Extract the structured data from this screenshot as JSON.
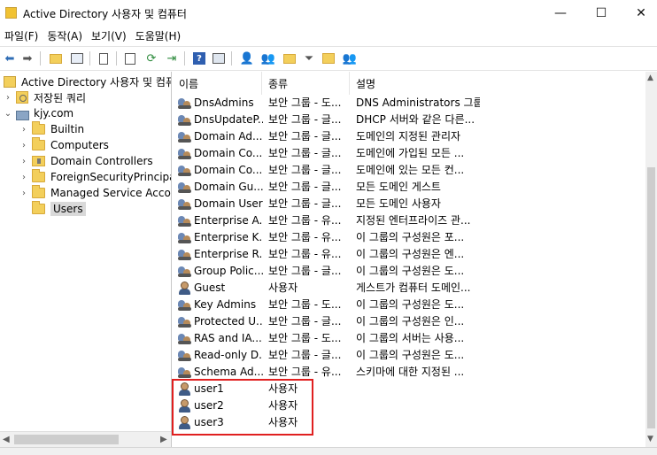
{
  "window": {
    "title": "Active Directory 사용자 및 컴퓨터",
    "icon": "ad-console-icon",
    "minimize_glyph": "—",
    "maximize_glyph": "☐",
    "close_glyph": "✕"
  },
  "menu": [
    {
      "label": "파일(F)"
    },
    {
      "label": "동작(A)"
    },
    {
      "label": "보기(V)"
    },
    {
      "label": "도움말(H)"
    }
  ],
  "toolbar": {
    "icons": [
      "back-arrow-icon",
      "forward-arrow-icon",
      "folder-up-icon",
      "tree-toggle-icon",
      "properties-icon",
      "export-list-icon",
      "refresh-icon",
      "export-icon",
      "help-icon",
      "console-icon",
      "new-user-icon",
      "new-group-icon",
      "new-ou-icon",
      "filter-icon",
      "find-icon",
      "add-to-group-icon"
    ]
  },
  "tree": {
    "root": "Active Directory 사용자 및 컴퓨터",
    "saved_queries": "저장된 쿼리",
    "domain": "kjy.com",
    "children": [
      {
        "label": "Builtin"
      },
      {
        "label": "Computers"
      },
      {
        "label": "Domain Controllers"
      },
      {
        "label": "ForeignSecurityPrincipals"
      },
      {
        "label": "Managed Service Accounts"
      },
      {
        "label": "Users"
      }
    ],
    "selected": "Users",
    "expand_glyph": "›",
    "expanded_glyph": "⌄"
  },
  "list": {
    "columns": [
      {
        "label": "이름"
      },
      {
        "label": "종류"
      },
      {
        "label": "설명"
      }
    ],
    "rows": [
      {
        "name": "DnsAdmins",
        "type": "보안 그룹 - 도...",
        "desc": "DNS Administrators 그룹",
        "icon": "group-icon"
      },
      {
        "name": "DnsUpdateP...",
        "type": "보안 그룹 - 글...",
        "desc": "DHCP 서버와 같은 다른...",
        "icon": "group-icon"
      },
      {
        "name": "Domain Ad...",
        "type": "보안 그룹 - 글...",
        "desc": "도메인의 지정된 관리자",
        "icon": "group-icon"
      },
      {
        "name": "Domain Co...",
        "type": "보안 그룹 - 글...",
        "desc": "도메인에 가입된 모든 ...",
        "icon": "group-icon"
      },
      {
        "name": "Domain Co...",
        "type": "보안 그룹 - 글...",
        "desc": "도메인에 있는 모든 컨...",
        "icon": "group-icon"
      },
      {
        "name": "Domain Gu...",
        "type": "보안 그룹 - 글...",
        "desc": "모든 도메인 게스트",
        "icon": "group-icon"
      },
      {
        "name": "Domain Users",
        "type": "보안 그룹 - 글...",
        "desc": "모든 도메인 사용자",
        "icon": "group-icon"
      },
      {
        "name": "Enterprise A...",
        "type": "보안 그룹 - 유...",
        "desc": "지정된 엔터프라이즈 관...",
        "icon": "group-icon"
      },
      {
        "name": "Enterprise K...",
        "type": "보안 그룹 - 유...",
        "desc": "이 그룹의 구성원은 포...",
        "icon": "group-icon"
      },
      {
        "name": "Enterprise R...",
        "type": "보안 그룹 - 유...",
        "desc": "이 그룹의 구성원은 엔...",
        "icon": "group-icon"
      },
      {
        "name": "Group Polic...",
        "type": "보안 그룹 - 글...",
        "desc": "이 그룹의 구성원은 도...",
        "icon": "group-icon"
      },
      {
        "name": "Guest",
        "type": "사용자",
        "desc": "게스트가 컴퓨터 도메인...",
        "icon": "user-icon"
      },
      {
        "name": "Key Admins",
        "type": "보안 그룹 - 도...",
        "desc": "이 그룹의 구성원은 도...",
        "icon": "group-icon"
      },
      {
        "name": "Protected U...",
        "type": "보안 그룹 - 글...",
        "desc": "이 그룹의 구성원은 인...",
        "icon": "group-icon"
      },
      {
        "name": "RAS and IA...",
        "type": "보안 그룹 - 도...",
        "desc": "이 그룹의 서버는 사용...",
        "icon": "group-icon"
      },
      {
        "name": "Read-only D...",
        "type": "보안 그룹 - 글...",
        "desc": "이 그룹의 구성원은 도...",
        "icon": "group-icon"
      },
      {
        "name": "Schema Ad...",
        "type": "보안 그룹 - 유...",
        "desc": "스키마에 대한 지정된 ...",
        "icon": "group-icon"
      },
      {
        "name": "user1",
        "type": "사용자",
        "desc": "",
        "icon": "user-icon"
      },
      {
        "name": "user2",
        "type": "사용자",
        "desc": "",
        "icon": "user-icon"
      },
      {
        "name": "user3",
        "type": "사용자",
        "desc": "",
        "icon": "user-icon"
      }
    ]
  },
  "colors": {
    "highlight_border": "#e02020",
    "selection_bg": "#d9d9d9",
    "folder": "#f3cf5b"
  }
}
